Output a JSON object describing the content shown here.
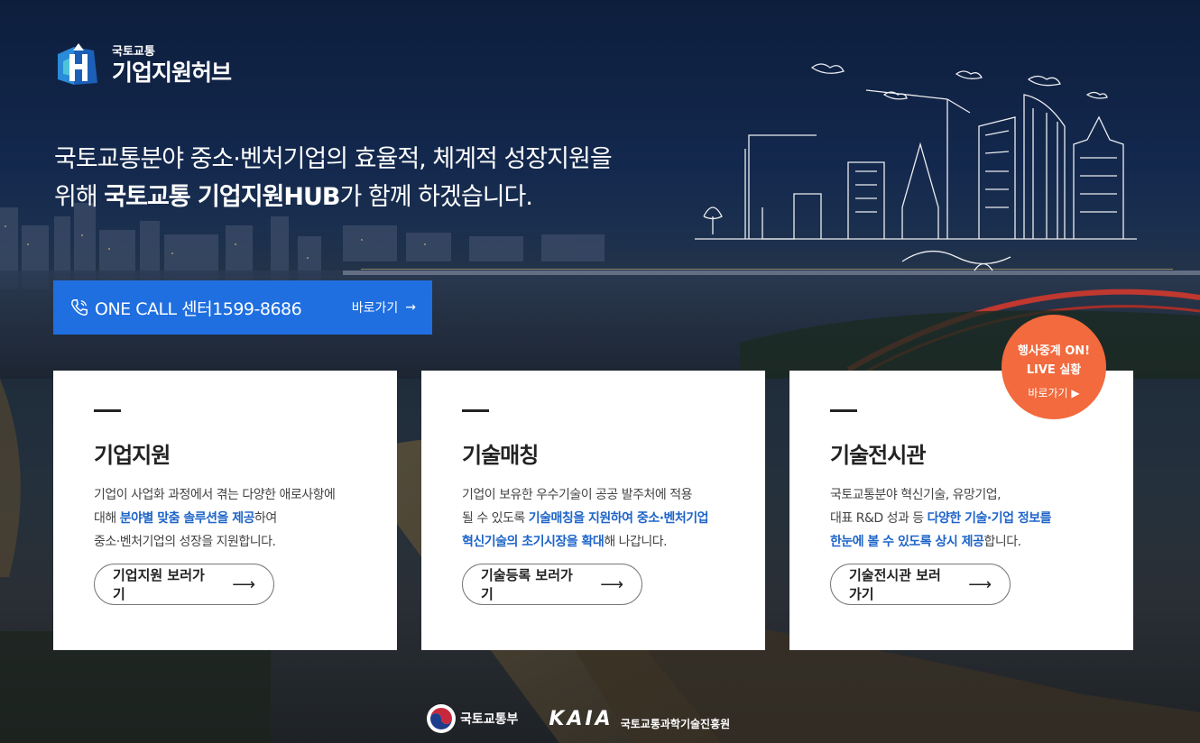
{
  "logo": {
    "small": "국토교통",
    "big": "기업지원허브"
  },
  "headline": {
    "line1": "국토교통분야 중소·벤처기업의 효율적, 체계적 성장지원을",
    "line2_prefix": "위해 ",
    "line2_bold": "국토교통 기업지원HUB",
    "line2_suffix": "가 함께 하겠습니다."
  },
  "onecall": {
    "label": "ONE CALL 센터1599-8686",
    "go": "바로가기",
    "icon": "phone-icon",
    "color": "#1f6fe0"
  },
  "cards": [
    {
      "title": "기업지원",
      "line1": "기업이 사업화 과정에서 겪는 다양한 애로사항에",
      "line2_prefix": "대해 ",
      "line2_hl": "분야별 맞춤 솔루션을 제공",
      "line2_suffix": "하여",
      "line3": "중소·벤처기업의 성장을 지원합니다.",
      "button": "기업지원 보러가기"
    },
    {
      "title": "기술매칭",
      "line1": "기업이 보유한 우수기술이 공공 발주처에 적용",
      "line2_prefix": "될 수 있도록 ",
      "line2_hl": "기술매칭을 지원하여 중소·벤처기업",
      "line3_hl": "혁신기술의 초기시장을 확대",
      "line3_suffix": "해 나갑니다.",
      "button": "기술등록 보러가기"
    },
    {
      "title": "기술전시관",
      "line1": "국토교통분야 혁신기술, 유망기업,",
      "line2_prefix": "대표 R&D 성과 등 ",
      "line2_hl": "다양한 기술·기업 정보를",
      "line3_hl": "한눈에 볼 수 있도록 상시 제공",
      "line3_suffix": "합니다.",
      "button": "기술전시관 보러가기"
    }
  ],
  "live": {
    "line1": "행사중계 ON!",
    "line2": "LIVE 실황",
    "go": "바로가기 ▶",
    "color": "#f26a3d"
  },
  "footer": {
    "molit": "국토교통부",
    "kaia_word": "KAIA",
    "kaia_name": "국토교통과학기술진흥원"
  },
  "colors": {
    "accent": "#1e64c8",
    "primary_button": "#1f6fe0",
    "live_badge": "#f26a3d"
  }
}
